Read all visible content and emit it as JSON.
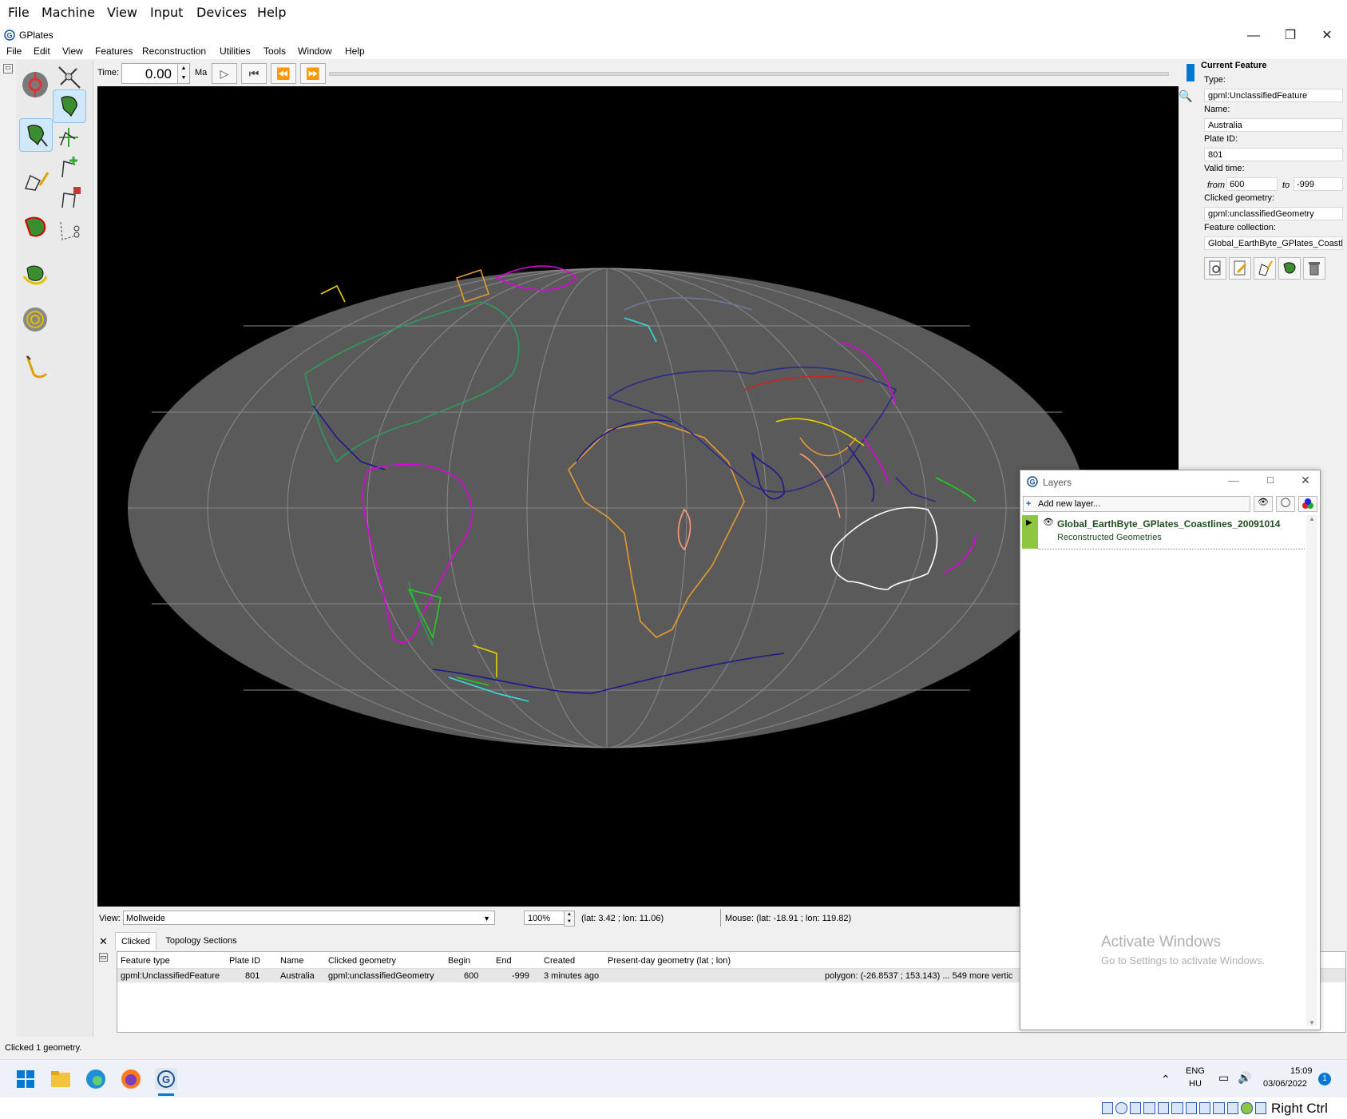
{
  "vm_menu": {
    "items": [
      "File",
      "Machine",
      "View",
      "Input",
      "Devices",
      "Help"
    ]
  },
  "window": {
    "title": "GPlates",
    "icon": "gplates-g-icon",
    "controls": [
      "minimize",
      "maximize",
      "close"
    ]
  },
  "main_menu": {
    "items": [
      "File",
      "Edit",
      "View",
      "Features",
      "Reconstruction",
      "Utilities",
      "Tools",
      "Window",
      "Help"
    ]
  },
  "tools": {
    "left_column": [
      "drag-globe-icon",
      "choose-feature-icon",
      "digitise-geometry-icon",
      "topology-icon",
      "pole-manipulation-icon",
      "small-circle-icon",
      "measure-distance-icon"
    ],
    "right_column": [
      "zoom-tool-icon",
      "select-feature-icon",
      "move-vertex-icon",
      "insert-vertex-icon",
      "delete-vertex-icon",
      "split-feature-icon"
    ]
  },
  "time_bar": {
    "label": "Time:",
    "value": "0.00",
    "unit": "Ma"
  },
  "view_bar": {
    "view_label": "View:",
    "projection": "Mollweide",
    "zoom": "100%",
    "camera_coords": "(lat: 3.42 ; lon: 11.06)",
    "mouse_coords": "Mouse: (lat: -18.91 ; lon: 119.82)"
  },
  "clicked_panel": {
    "tabs": [
      "Clicked",
      "Topology Sections"
    ],
    "columns": [
      "Feature type",
      "Plate ID",
      "Name",
      "Clicked geometry",
      "Begin",
      "End",
      "Created",
      "Present-day geometry (lat ; lon)"
    ],
    "rows": [
      [
        "gpml:UnclassifiedFeature",
        "801",
        "Australia",
        "gpml:unclassifiedGeometry",
        "600",
        "-999",
        "3 minutes ago",
        "polygon: (-26.8537 ; 153.143) ... 549 more vertic"
      ]
    ]
  },
  "status_line": "Clicked 1 geometry.",
  "current_feature": {
    "heading": "Current Feature",
    "type_label": "Type:",
    "type": "gpml:UnclassifiedFeature",
    "name_label": "Name:",
    "name": "Australia",
    "plate_label": "Plate ID:",
    "plate_id": "801",
    "valid_label": "Valid time:",
    "from_label": "from",
    "from": "600",
    "to_label": "to",
    "to": "-999",
    "geom_label": "Clicked geometry:",
    "geometry": "gpml:unclassifiedGeometry",
    "coll_label": "Feature collection:",
    "collection": "Global_EarthByte_GPlates_Coastline",
    "action_icons": [
      "query-feature-icon",
      "edit-feature-icon",
      "clone-geometry-icon",
      "reconstruct-icon",
      "delete-feature-icon"
    ]
  },
  "layers_window": {
    "title": "Layers",
    "add_label": "Add new layer...",
    "layer_name": "Global_EarthByte_GPlates_Coastlines_20091014",
    "layer_type": "Reconstructed Geometries",
    "watermark_title": "Activate Windows",
    "watermark_sub": "Go to Settings to activate Windows."
  },
  "taskbar": {
    "apps": [
      "windows-start-icon",
      "file-explorer-icon",
      "edge-icon",
      "firefox-icon",
      "gplates-icon"
    ],
    "lang_top": "ENG",
    "lang_bottom": "HU",
    "time": "15:09",
    "date": "03/06/2022",
    "notification_count": "1"
  },
  "vm_status": {
    "host_key": "Right Ctrl"
  },
  "colors": {
    "accent": "#0078d4",
    "globe": "#5a5a5a",
    "canvas": "#000000",
    "layer_marker": "#8dc63f"
  }
}
